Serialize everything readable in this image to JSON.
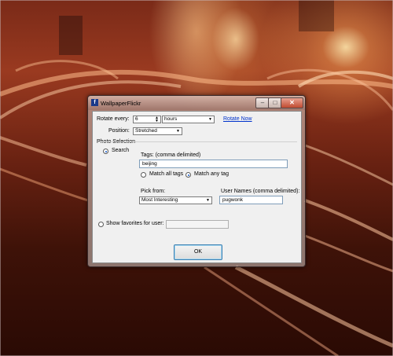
{
  "window": {
    "title": "WallpaperFlickr",
    "icon": "flickr-app-icon"
  },
  "rotate": {
    "label": "Rotate every:",
    "value": "6",
    "unit": "hours",
    "rotate_now": "Rotate Now"
  },
  "position": {
    "label": "Position:",
    "value": "Stretched"
  },
  "photo_selection": {
    "header": "Photo Selection",
    "search_label": "Search",
    "search_checked": true,
    "tags_label": "Tags:  (comma delimited)",
    "tags_value": "beijing",
    "match_all_label": "Match all tags",
    "match_any_label": "Match any tag",
    "match_any_checked": true,
    "pick_from_label": "Pick from:",
    "pick_from_value": "Most Interesting",
    "user_names_label": "User Names (comma delimited):",
    "user_names_value": "pugwonk",
    "favorites_label": "Show favorites for user:",
    "favorites_value": ""
  },
  "ok_label": "OK",
  "colors": {
    "accent": "#1a5fd0",
    "link": "#0033cc"
  }
}
